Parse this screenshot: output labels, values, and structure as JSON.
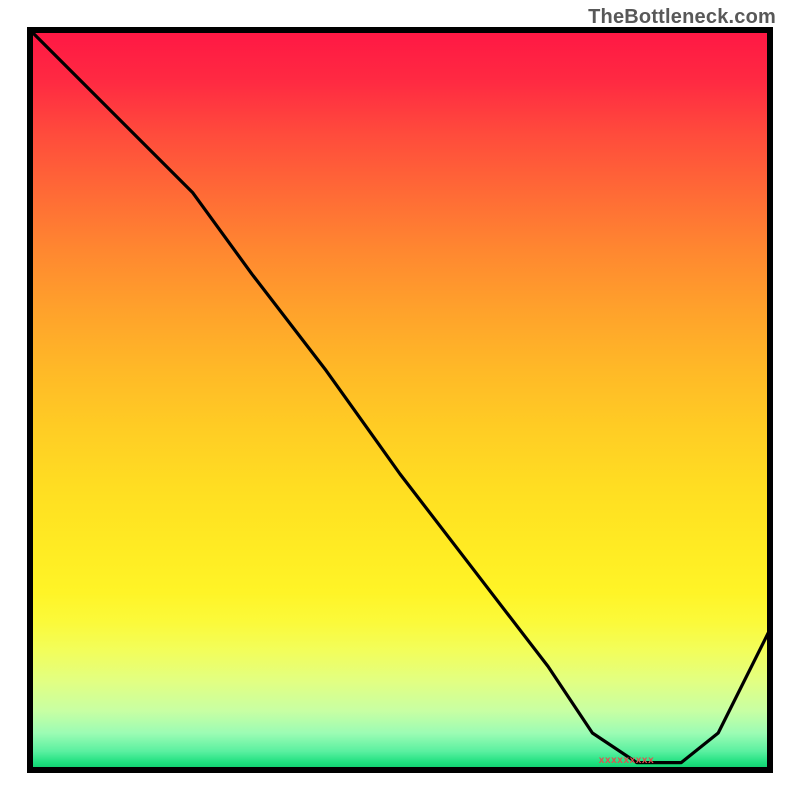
{
  "watermark": "TheBottleneck.com",
  "marker_label": "xxxxxxxxx",
  "chart_data": {
    "type": "line",
    "title": "",
    "xlabel": "",
    "ylabel": "",
    "xlim": [
      0,
      100
    ],
    "ylim": [
      0,
      100
    ],
    "x": [
      0,
      5,
      15,
      22,
      30,
      40,
      50,
      60,
      70,
      76,
      82,
      88,
      93,
      100
    ],
    "values": [
      100,
      95,
      85,
      78,
      67,
      54,
      40,
      27,
      14,
      5,
      1,
      1,
      5,
      19
    ],
    "valley_x_range": [
      76,
      88
    ],
    "annotations": [
      {
        "label_key": "marker_label",
        "x": 82,
        "y": 1
      }
    ],
    "background": "heat-gradient (red top → yellow mid → green bottom)"
  }
}
